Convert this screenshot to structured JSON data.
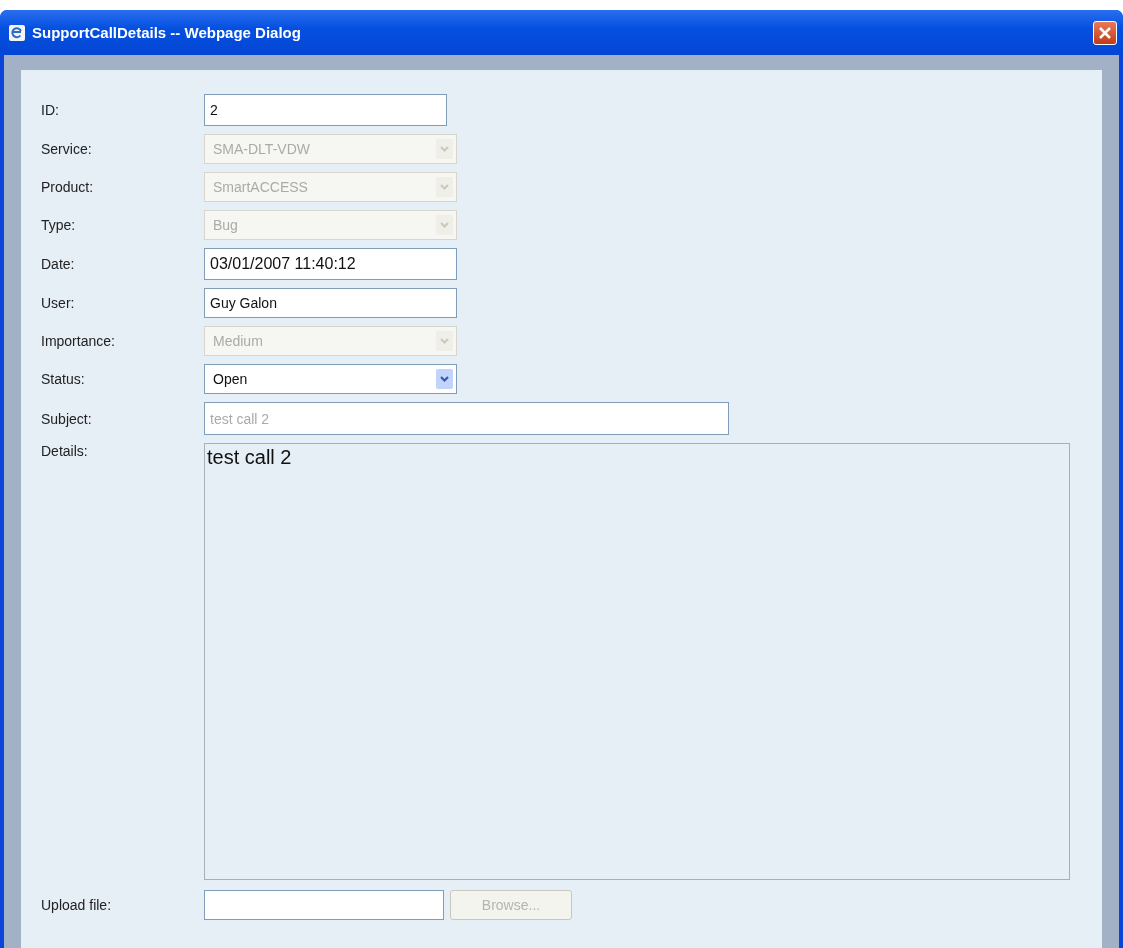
{
  "window": {
    "title": "SupportCallDetails -- Webpage Dialog"
  },
  "fields": [
    {
      "label": "ID:",
      "kind": "text",
      "value": "2",
      "disabled": false
    },
    {
      "label": "Service:",
      "kind": "select",
      "value": "SMA-DLT-VDW",
      "disabled": true
    },
    {
      "label": "Product:",
      "kind": "select",
      "value": "SmartACCESS",
      "disabled": true
    },
    {
      "label": "Type:",
      "kind": "select",
      "value": "Bug",
      "disabled": true
    },
    {
      "label": "Date:",
      "kind": "text",
      "value": "03/01/2007 11:40:12",
      "disabled": false
    },
    {
      "label": "User:",
      "kind": "text",
      "value": "Guy Galon",
      "disabled": false
    },
    {
      "label": "Importance:",
      "kind": "select",
      "value": "Medium",
      "disabled": true
    },
    {
      "label": "Status:",
      "kind": "select",
      "value": "Open",
      "disabled": false
    },
    {
      "label": "Subject:",
      "kind": "wide",
      "value": "test call 2",
      "disabled": true
    },
    {
      "label": "Details:",
      "kind": "textarea",
      "value": "test call 2",
      "disabled": false
    },
    {
      "label": "Upload file:",
      "kind": "file",
      "button": "Browse...",
      "disabled": true
    }
  ]
}
